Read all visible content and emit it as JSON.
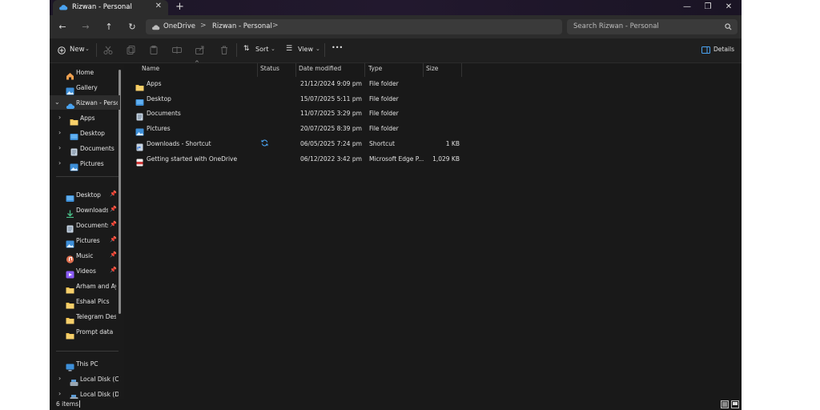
{
  "window": {
    "tab_title": "Rizwan - Personal",
    "tab_close": "✕",
    "new_tab": "+",
    "minimize": "—",
    "restore": "❐",
    "close": "✕"
  },
  "nav": {
    "back": "←",
    "forward": "→",
    "up": "↑",
    "refresh": "↻"
  },
  "address": {
    "crumbs": [
      "OneDrive",
      "Rizwan - Personal"
    ],
    "separator": ">"
  },
  "search": {
    "placeholder": "Search Rizwan - Personal"
  },
  "toolbar": {
    "new_label": "New",
    "sort_label": "Sort",
    "view_label": "View",
    "more_label": "•••",
    "details_label": "Details"
  },
  "sidebar": {
    "top": [
      {
        "label": "Home",
        "icon": "home-icon"
      },
      {
        "label": "Gallery",
        "icon": "gallery-icon"
      }
    ],
    "onedrive": {
      "label": "Rizwan - Personal",
      "icon": "cloud-icon",
      "expanded": true
    },
    "onedrive_children": [
      {
        "label": "Apps",
        "icon": "folder-icon"
      },
      {
        "label": "Desktop",
        "icon": "desktop-icon"
      },
      {
        "label": "Documents",
        "icon": "documents-icon"
      },
      {
        "label": "Pictures",
        "icon": "pictures-icon"
      }
    ],
    "quick_access": [
      {
        "label": "Desktop",
        "icon": "desktop-icon",
        "pinned": true
      },
      {
        "label": "Downloads",
        "icon": "download-icon",
        "pinned": true
      },
      {
        "label": "Documents",
        "icon": "documents-icon",
        "pinned": true
      },
      {
        "label": "Pictures",
        "icon": "pictures-icon",
        "pinned": true
      },
      {
        "label": "Music",
        "icon": "music-icon",
        "pinned": true
      },
      {
        "label": "Videos",
        "icon": "videos-icon",
        "pinned": true
      },
      {
        "label": "Arham and Aya",
        "icon": "folder-icon",
        "pinned": false
      },
      {
        "label": "Eshaal Pics",
        "icon": "folder-icon",
        "pinned": false
      },
      {
        "label": "Telegram Deskto",
        "icon": "folder-icon",
        "pinned": false
      },
      {
        "label": "Prompt data",
        "icon": "folder-icon",
        "pinned": false
      }
    ],
    "this_pc": {
      "label": "This PC",
      "icon": "monitor-icon"
    },
    "drives": [
      {
        "label": "Local Disk (C:)",
        "icon": "drive-icon"
      },
      {
        "label": "Local Disk (D:)",
        "icon": "drive-icon"
      }
    ],
    "pin_glyph": "📌"
  },
  "columns": {
    "name": "Name",
    "status": "Status",
    "date": "Date modified",
    "type": "Type",
    "size": "Size"
  },
  "files": [
    {
      "name": "Apps",
      "status": "",
      "date": "21/12/2024 9:09 pm",
      "type": "File folder",
      "size": "",
      "icon": "folder-icon"
    },
    {
      "name": "Desktop",
      "status": "",
      "date": "15/07/2025 5:11 pm",
      "type": "File folder",
      "size": "",
      "icon": "desktop-icon"
    },
    {
      "name": "Documents",
      "status": "",
      "date": "11/07/2025 3:29 pm",
      "type": "File folder",
      "size": "",
      "icon": "documents-icon"
    },
    {
      "name": "Pictures",
      "status": "",
      "date": "20/07/2025 8:39 pm",
      "type": "File folder",
      "size": "",
      "icon": "pictures-icon"
    },
    {
      "name": "Downloads - Shortcut",
      "status": "sync-icon",
      "date": "06/05/2025 7:24 pm",
      "type": "Shortcut",
      "size": "1 KB",
      "icon": "shortcut-icon"
    },
    {
      "name": "Getting started with OneDrive",
      "status": "",
      "date": "06/12/2022 3:42 pm",
      "type": "Microsoft Edge P...",
      "size": "1,029 KB",
      "icon": "pdf-icon"
    }
  ],
  "status_bar": {
    "item_count": "6 items"
  },
  "colors": {
    "background": "#191919",
    "folder": "#f2c14e",
    "accent": "#4aa3f0",
    "pdf": "#d33b3b"
  }
}
